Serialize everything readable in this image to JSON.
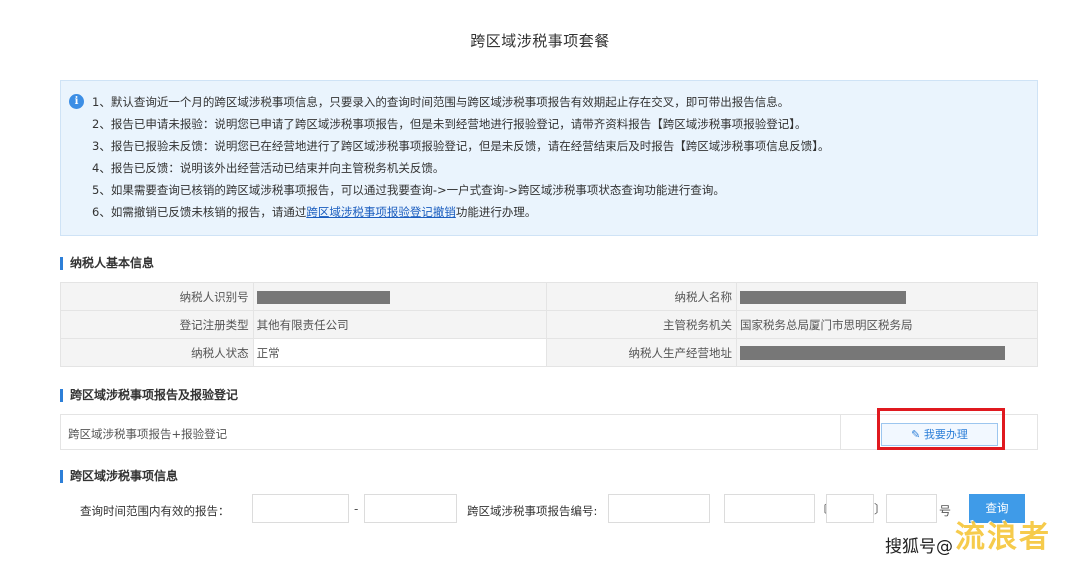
{
  "page": {
    "title": "跨区域涉税事项套餐"
  },
  "notice": {
    "icon": "info-icon",
    "lines": [
      "1、默认查询近一个月的跨区域涉税事项信息，只要录入的查询时间范围与跨区域涉税事项报告有效期起止存在交叉，即可带出报告信息。",
      "2、报告已申请未报验：说明您已申请了跨区域涉税事项报告，但是未到经营地进行报验登记，请带齐资料报告【跨区域涉税事项报验登记】。",
      "3、报告已报验未反馈：说明您已在经营地进行了跨区域涉税事项报验登记，但是未反馈，请在经营结束后及时报告【跨区域涉税事项信息反馈】。",
      "4、报告已反馈：说明该外出经营活动已结束并向主管税务机关反馈。",
      "5、如果需要查询已核销的跨区域涉税事项报告，可以通过我要查询->一户式查询->跨区域涉税事项状态查询功能进行查询。"
    ],
    "line6_prefix": "6、如需撤销已反馈未核销的报告，请通过",
    "line6_link": "跨区域涉税事项报验登记撤销",
    "line6_suffix": "功能进行办理。"
  },
  "taxpayer_section": {
    "title": "纳税人基本信息",
    "fields": [
      {
        "label": "纳税人识别号",
        "value": ""
      },
      {
        "label": "纳税人名称",
        "value": ""
      },
      {
        "label": "登记注册类型",
        "value": "其他有限责任公司"
      },
      {
        "label": "主管税务机关",
        "value": "国家税务总局厦门市思明区税务局"
      },
      {
        "label": "纳税人状态",
        "value": "正常"
      },
      {
        "label": "纳税人生产经营地址",
        "value": ""
      }
    ]
  },
  "report_section": {
    "title": "跨区域涉税事项报告及报验登记",
    "row_label": "跨区域涉税事项报告+报验登记",
    "apply_button": "我要办理",
    "apply_icon": "edit-icon"
  },
  "query_section": {
    "title": "跨区域涉税事项信息",
    "date_range_label": "查询时间范围内有效的报告：",
    "range_separator": "-",
    "report_number_label": "跨区域涉税事项报告编号:",
    "bracket_open": "〔",
    "bracket_close": "〕",
    "number_suffix": "号",
    "query_button": "查询"
  },
  "watermark": {
    "sohu_text": "搜狐号@",
    "logo_text": "流浪者"
  },
  "colors": {
    "accent": "#2d7fd8",
    "notice_bg": "#eaf4fd",
    "highlight": "#e0191f",
    "query_button": "#3f9be8"
  }
}
